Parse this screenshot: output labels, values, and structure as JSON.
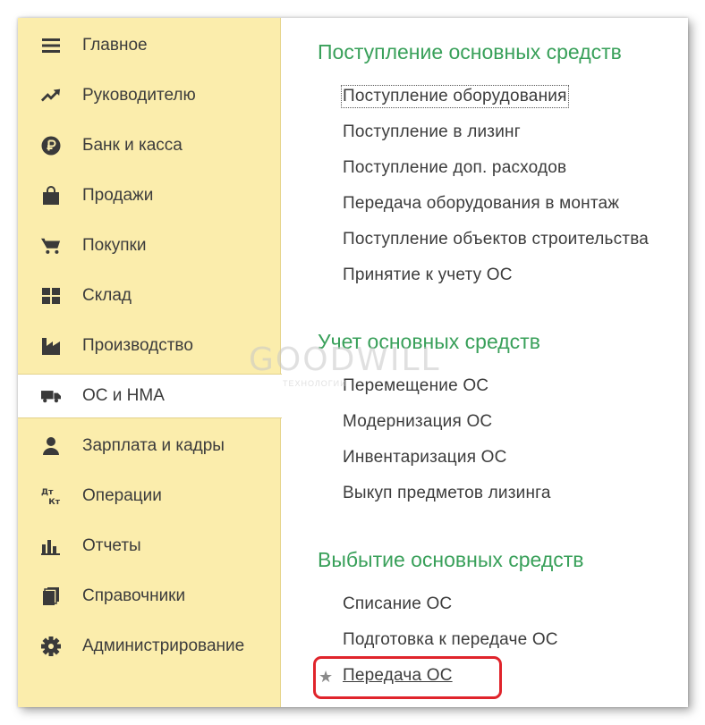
{
  "sidebar": {
    "items": [
      {
        "label": "Главное",
        "icon": "menu-lines-icon"
      },
      {
        "label": "Руководителю",
        "icon": "trend-up-icon"
      },
      {
        "label": "Банк и касса",
        "icon": "ruble-coin-icon"
      },
      {
        "label": "Продажи",
        "icon": "shopping-bag-icon"
      },
      {
        "label": "Покупки",
        "icon": "shopping-cart-icon"
      },
      {
        "label": "Склад",
        "icon": "warehouse-grid-icon"
      },
      {
        "label": "Производство",
        "icon": "factory-icon"
      },
      {
        "label": "ОС и НМА",
        "icon": "truck-icon",
        "active": true
      },
      {
        "label": "Зарплата и кадры",
        "icon": "person-icon"
      },
      {
        "label": "Операции",
        "icon": "debit-credit-icon"
      },
      {
        "label": "Отчеты",
        "icon": "bar-chart-icon"
      },
      {
        "label": "Справочники",
        "icon": "books-icon"
      },
      {
        "label": "Администрирование",
        "icon": "gear-icon"
      }
    ]
  },
  "sections": [
    {
      "title": "Поступление основных средств",
      "links": [
        "Поступление оборудования",
        "Поступление в лизинг",
        "Поступление доп. расходов",
        "Передача оборудования в монтаж",
        "Поступление объектов строительства",
        "Принятие к учету ОС"
      ]
    },
    {
      "title": "Учет основных средств",
      "links": [
        "Перемещение ОС",
        "Модернизация ОС",
        "Инвентаризация ОС",
        "Выкуп предметов лизинга"
      ]
    },
    {
      "title": "Выбытие основных средств",
      "links": [
        "Списание ОС",
        "Подготовка к передаче ОС",
        "Передача ОС"
      ]
    }
  ],
  "favorite_mark": "★",
  "watermark": {
    "main": "GOODWILL",
    "sub": "ТЕХНОЛОГИИ"
  },
  "colors": {
    "sidebar_bg": "#fbedac",
    "section_title": "#39a05a",
    "highlight": "#e0242b",
    "text": "#3c3c3c"
  }
}
